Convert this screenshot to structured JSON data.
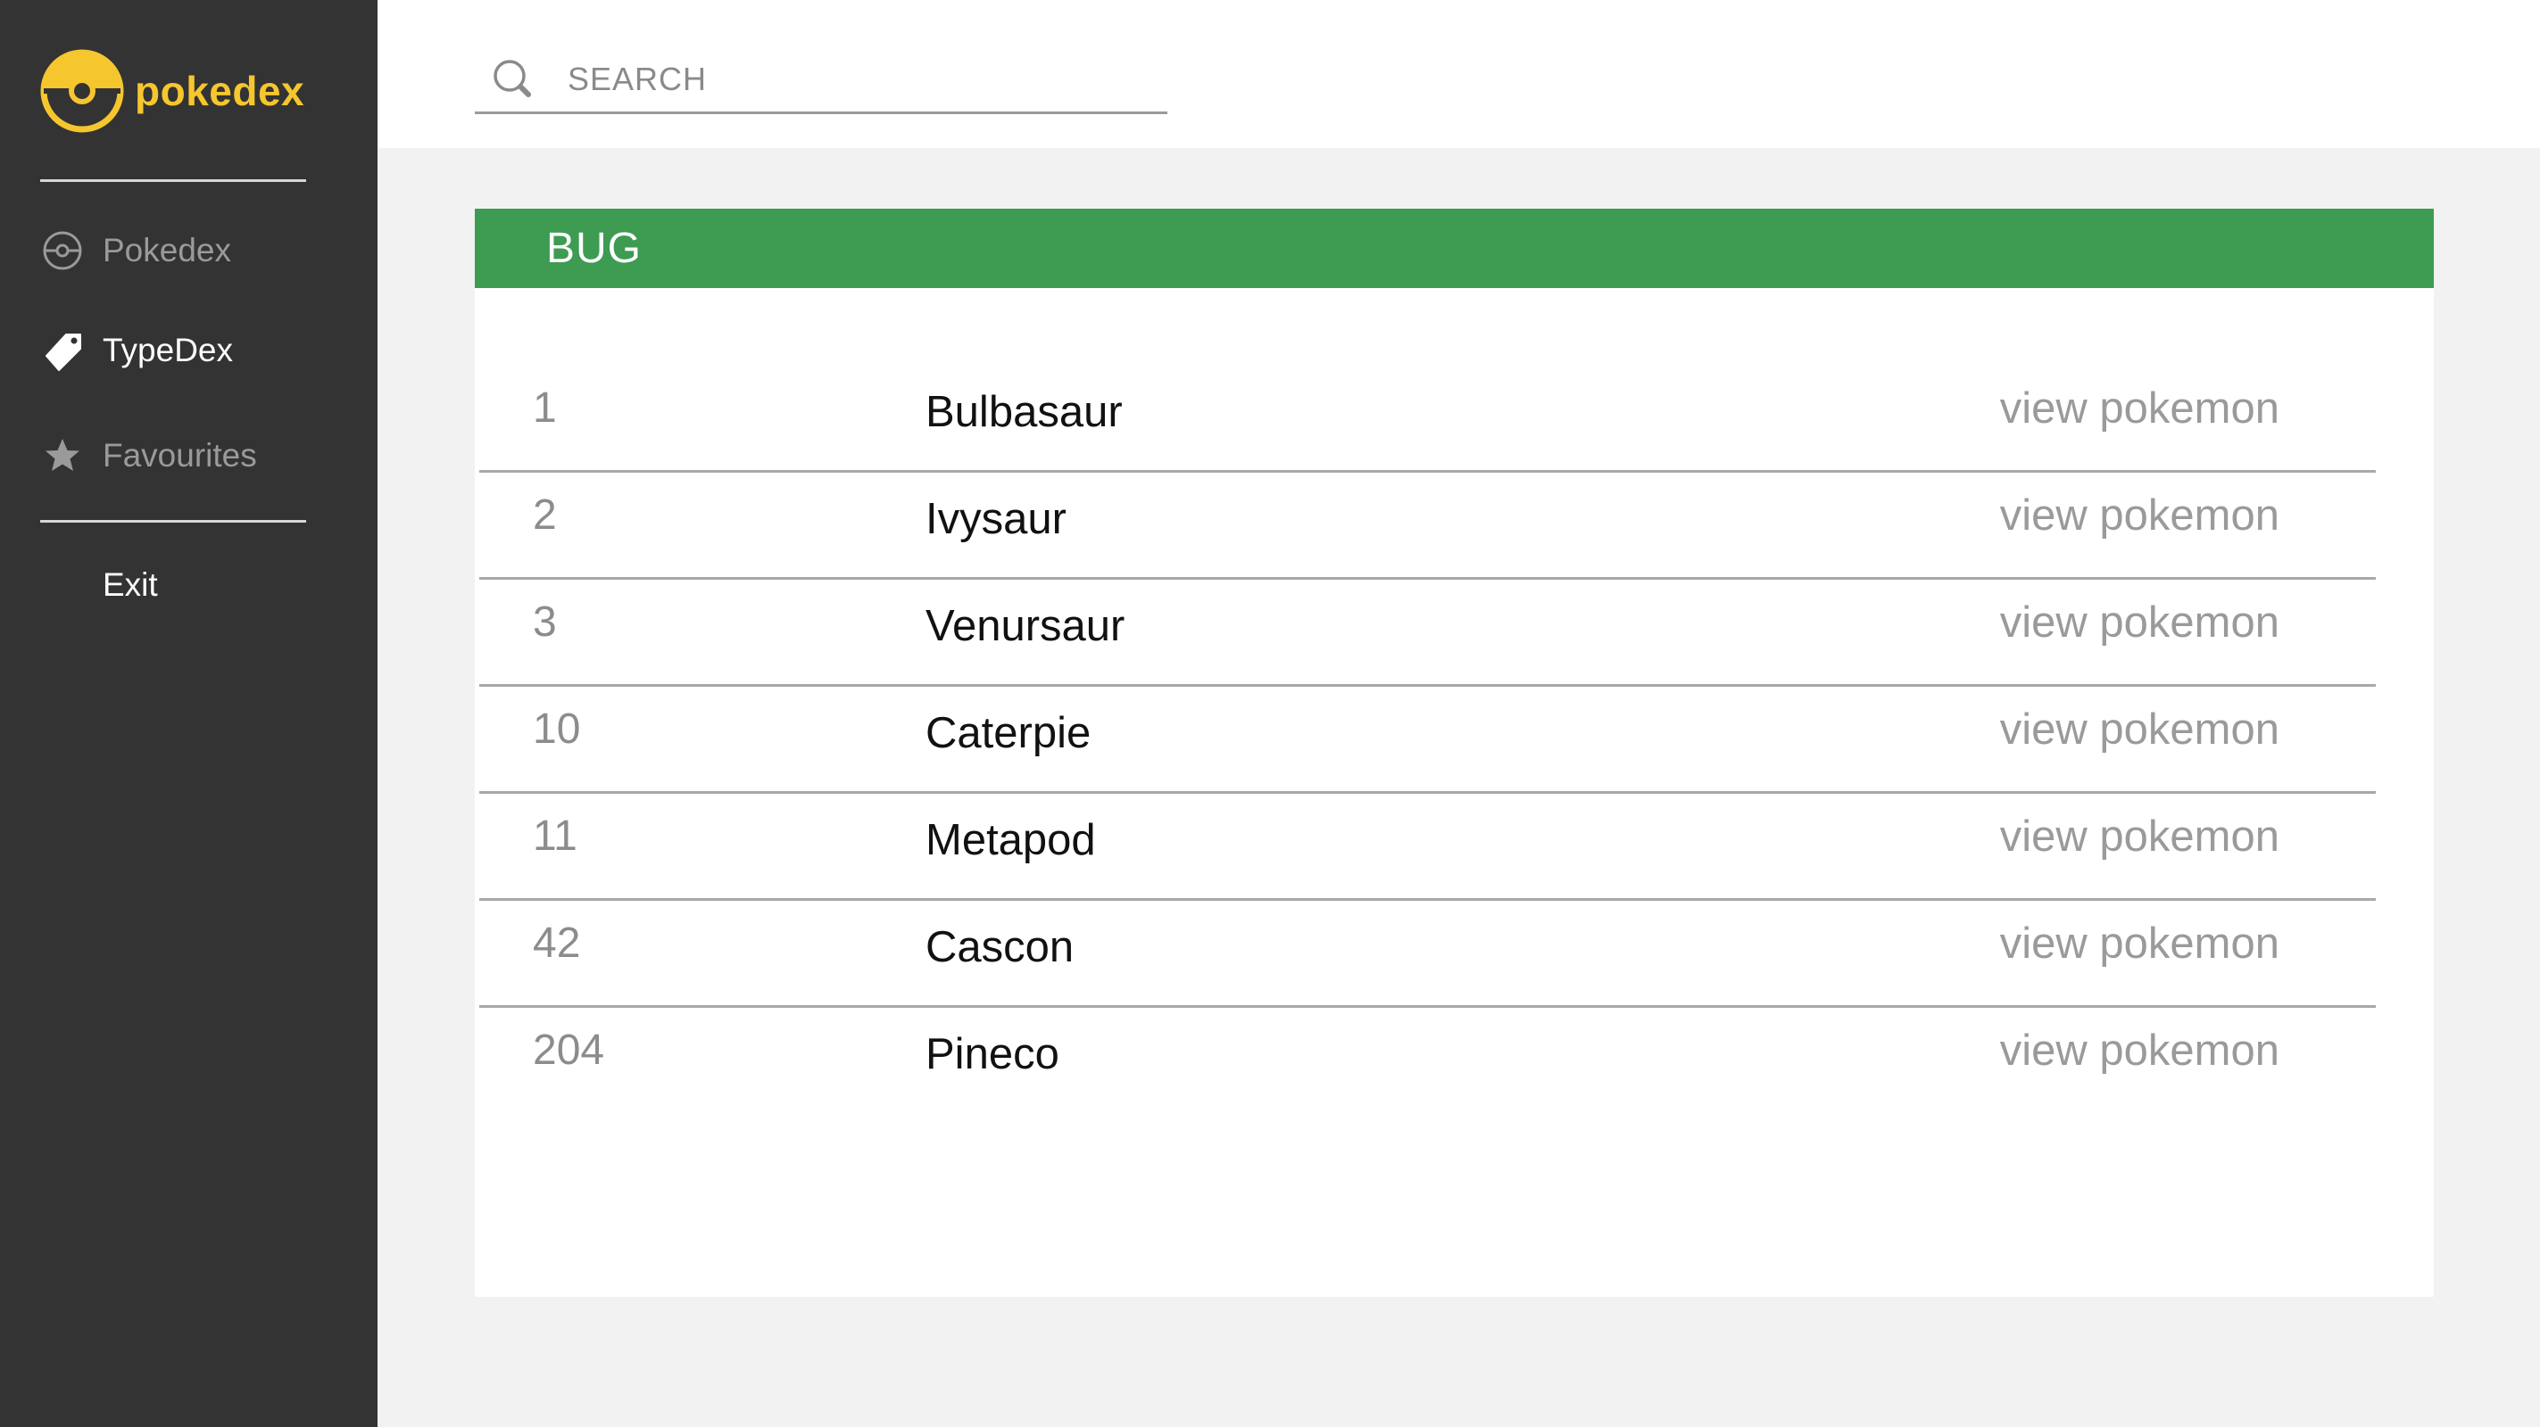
{
  "brand": {
    "name": "pokedex",
    "icon": "pokeball-icon",
    "color": "#f5c62e"
  },
  "sidebar": {
    "items": [
      {
        "label": "Pokedex",
        "icon": "pokeball-outline-icon",
        "active": false
      },
      {
        "label": "TypeDex",
        "icon": "tag-icon",
        "active": true
      },
      {
        "label": "Favourites",
        "icon": "star-icon",
        "active": false
      }
    ],
    "exit_label": "Exit"
  },
  "search": {
    "placeholder": "SEARCH",
    "value": "",
    "icon": "search-icon"
  },
  "type_card": {
    "title": "BUG",
    "header_color": "#3d9b52",
    "rows": [
      {
        "number": "1",
        "name": "Bulbasaur",
        "action": "view pokemon"
      },
      {
        "number": "2",
        "name": "Ivysaur",
        "action": "view pokemon"
      },
      {
        "number": "3",
        "name": "Venursaur",
        "action": "view pokemon"
      },
      {
        "number": "10",
        "name": "Caterpie",
        "action": "view pokemon"
      },
      {
        "number": "11",
        "name": "Metapod",
        "action": "view pokemon"
      },
      {
        "number": "42",
        "name": "Cascon",
        "action": "view pokemon"
      },
      {
        "number": "204",
        "name": "Pineco",
        "action": "view pokemon"
      }
    ]
  }
}
